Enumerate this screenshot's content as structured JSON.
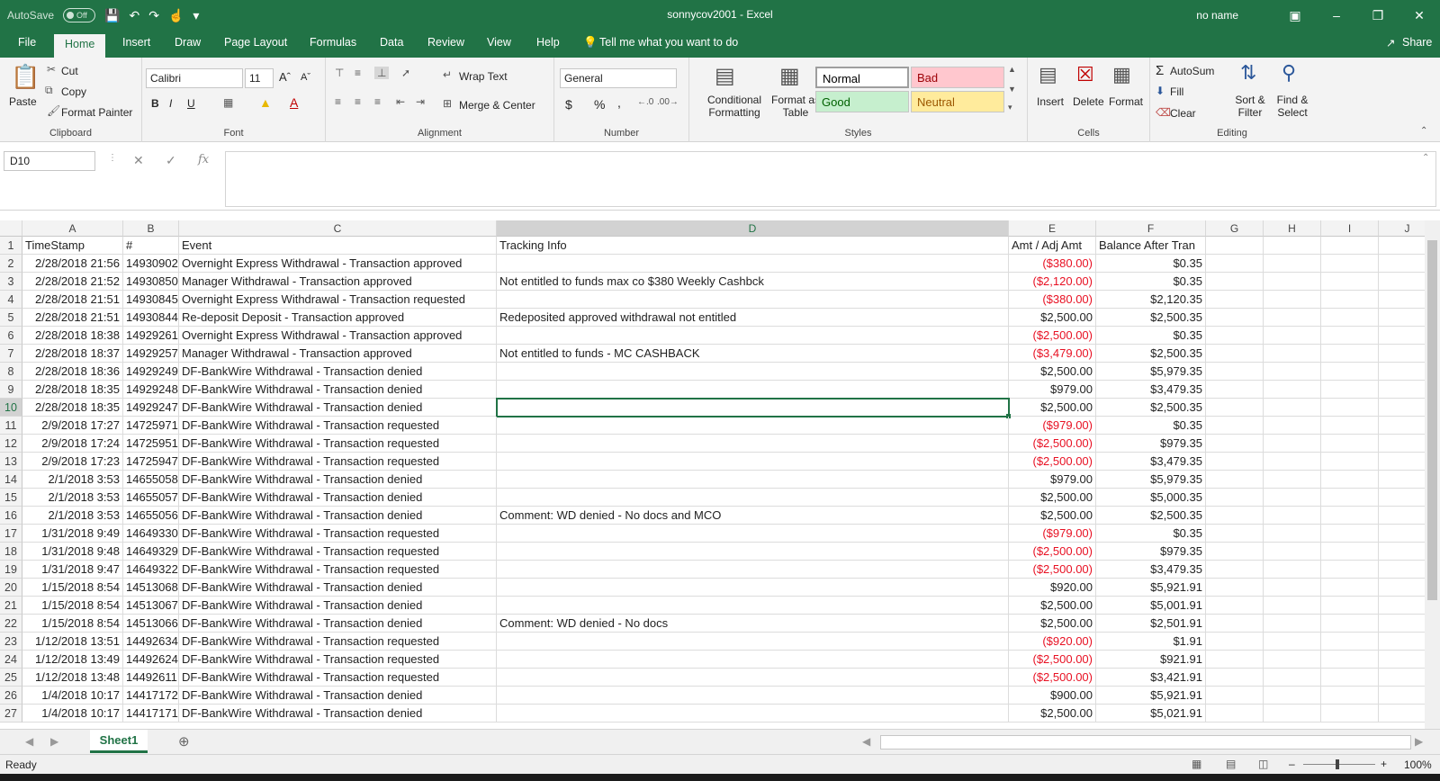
{
  "titlebar": {
    "autosave_label": "AutoSave",
    "autosave_state": "Off",
    "document_title": "sonnycov2001 - Excel",
    "user": "no name"
  },
  "tabs": [
    "File",
    "Home",
    "Insert",
    "Draw",
    "Page Layout",
    "Formulas",
    "Data",
    "Review",
    "View",
    "Help"
  ],
  "active_tab": "Home",
  "tell_me": "Tell me what you want to do",
  "share": "Share",
  "ribbon": {
    "clipboard": {
      "label": "Clipboard",
      "paste": "Paste",
      "cut": "Cut",
      "copy": "Copy",
      "format_painter": "Format Painter"
    },
    "font": {
      "label": "Font",
      "name": "Calibri",
      "size": "11",
      "bold": "B",
      "italic": "I",
      "underline": "U"
    },
    "alignment": {
      "label": "Alignment",
      "wrap_text": "Wrap Text",
      "merge_center": "Merge & Center"
    },
    "number": {
      "label": "Number",
      "format": "General",
      "currency": "$",
      "percent": "%",
      "comma": ","
    },
    "styles": {
      "label": "Styles",
      "conditional_formatting": "Conditional Formatting",
      "format_as_table": "Format as Table",
      "normal": "Normal",
      "bad": "Bad",
      "good": "Good",
      "neutral": "Neutral"
    },
    "cells": {
      "label": "Cells",
      "insert": "Insert",
      "delete": "Delete",
      "format": "Format"
    },
    "editing": {
      "label": "Editing",
      "autosum": "AutoSum",
      "fill": "Fill",
      "clear": "Clear",
      "sort_filter": "Sort & Filter",
      "find_select": "Find & Select"
    }
  },
  "formula_bar": {
    "name_box": "D10",
    "fx": "fx",
    "formula": ""
  },
  "sheet": {
    "columns": [
      "A",
      "B",
      "C",
      "D",
      "E",
      "F",
      "G",
      "H",
      "I",
      "J"
    ],
    "selected_column": "D",
    "selected_row": "10",
    "header_row": [
      "TimeStamp",
      "#",
      "Event",
      "Tracking Info",
      "Amt / Adj Amt",
      "Balance After Tran"
    ],
    "rows": [
      {
        "n": "2",
        "a": "2/28/2018 21:56",
        "b": "14930902",
        "c": "Overnight Express Withdrawal - Transaction approved",
        "d": "",
        "e": "($380.00)",
        "neg": true,
        "f": "$0.35"
      },
      {
        "n": "3",
        "a": "2/28/2018 21:52",
        "b": "14930850",
        "c": "Manager Withdrawal - Transaction approved",
        "d": "Not entitled to funds max co $380 Weekly Cashbck",
        "e": "($2,120.00)",
        "neg": true,
        "f": "$0.35"
      },
      {
        "n": "4",
        "a": "2/28/2018 21:51",
        "b": "14930845",
        "c": "Overnight Express Withdrawal - Transaction requested",
        "d": "",
        "e": "($380.00)",
        "neg": true,
        "f": "$2,120.35"
      },
      {
        "n": "5",
        "a": "2/28/2018 21:51",
        "b": "14930844",
        "c": "Re-deposit Deposit - Transaction approved",
        "d": "Redeposited approved withdrawal not entitled",
        "e": "$2,500.00",
        "neg": false,
        "f": "$2,500.35"
      },
      {
        "n": "6",
        "a": "2/28/2018 18:38",
        "b": "14929261",
        "c": "Overnight Express Withdrawal - Transaction approved",
        "d": "",
        "e": "($2,500.00)",
        "neg": true,
        "f": "$0.35"
      },
      {
        "n": "7",
        "a": "2/28/2018 18:37",
        "b": "14929257",
        "c": "Manager Withdrawal - Transaction approved",
        "d": "Not entitled to funds - MC CASHBACK",
        "e": "($3,479.00)",
        "neg": true,
        "f": "$2,500.35"
      },
      {
        "n": "8",
        "a": "2/28/2018 18:36",
        "b": "14929249",
        "c": "DF-BankWire Withdrawal - Transaction denied",
        "d": "",
        "e": "$2,500.00",
        "neg": false,
        "f": "$5,979.35"
      },
      {
        "n": "9",
        "a": "2/28/2018 18:35",
        "b": "14929248",
        "c": "DF-BankWire Withdrawal - Transaction denied",
        "d": "",
        "e": "$979.00",
        "neg": false,
        "f": "$3,479.35"
      },
      {
        "n": "10",
        "a": "2/28/2018 18:35",
        "b": "14929247",
        "c": "DF-BankWire Withdrawal - Transaction denied",
        "d": "",
        "e": "$2,500.00",
        "neg": false,
        "f": "$2,500.35"
      },
      {
        "n": "11",
        "a": "2/9/2018 17:27",
        "b": "14725971",
        "c": "DF-BankWire Withdrawal - Transaction requested",
        "d": "",
        "e": "($979.00)",
        "neg": true,
        "f": "$0.35"
      },
      {
        "n": "12",
        "a": "2/9/2018 17:24",
        "b": "14725951",
        "c": "DF-BankWire Withdrawal - Transaction requested",
        "d": "",
        "e": "($2,500.00)",
        "neg": true,
        "f": "$979.35"
      },
      {
        "n": "13",
        "a": "2/9/2018 17:23",
        "b": "14725947",
        "c": "DF-BankWire Withdrawal - Transaction requested",
        "d": "",
        "e": "($2,500.00)",
        "neg": true,
        "f": "$3,479.35"
      },
      {
        "n": "14",
        "a": "2/1/2018 3:53",
        "b": "14655058",
        "c": "DF-BankWire Withdrawal - Transaction denied",
        "d": "",
        "e": "$979.00",
        "neg": false,
        "f": "$5,979.35"
      },
      {
        "n": "15",
        "a": "2/1/2018 3:53",
        "b": "14655057",
        "c": "DF-BankWire Withdrawal - Transaction denied",
        "d": "",
        "e": "$2,500.00",
        "neg": false,
        "f": "$5,000.35"
      },
      {
        "n": "16",
        "a": "2/1/2018 3:53",
        "b": "14655056",
        "c": "DF-BankWire Withdrawal - Transaction denied",
        "d": "Comment: WD denied - No docs and MCO",
        "e": "$2,500.00",
        "neg": false,
        "f": "$2,500.35"
      },
      {
        "n": "17",
        "a": "1/31/2018 9:49",
        "b": "14649330",
        "c": "DF-BankWire Withdrawal - Transaction requested",
        "d": "",
        "e": "($979.00)",
        "neg": true,
        "f": "$0.35"
      },
      {
        "n": "18",
        "a": "1/31/2018 9:48",
        "b": "14649329",
        "c": "DF-BankWire Withdrawal - Transaction requested",
        "d": "",
        "e": "($2,500.00)",
        "neg": true,
        "f": "$979.35"
      },
      {
        "n": "19",
        "a": "1/31/2018 9:47",
        "b": "14649322",
        "c": "DF-BankWire Withdrawal - Transaction requested",
        "d": "",
        "e": "($2,500.00)",
        "neg": true,
        "f": "$3,479.35"
      },
      {
        "n": "20",
        "a": "1/15/2018 8:54",
        "b": "14513068",
        "c": "DF-BankWire Withdrawal - Transaction denied",
        "d": "",
        "e": "$920.00",
        "neg": false,
        "f": "$5,921.91"
      },
      {
        "n": "21",
        "a": "1/15/2018 8:54",
        "b": "14513067",
        "c": "DF-BankWire Withdrawal - Transaction denied",
        "d": "",
        "e": "$2,500.00",
        "neg": false,
        "f": "$5,001.91"
      },
      {
        "n": "22",
        "a": "1/15/2018 8:54",
        "b": "14513066",
        "c": "DF-BankWire Withdrawal - Transaction denied",
        "d": "Comment: WD denied - No docs",
        "e": "$2,500.00",
        "neg": false,
        "f": "$2,501.91"
      },
      {
        "n": "23",
        "a": "1/12/2018 13:51",
        "b": "14492634",
        "c": "DF-BankWire Withdrawal - Transaction requested",
        "d": "",
        "e": "($920.00)",
        "neg": true,
        "f": "$1.91"
      },
      {
        "n": "24",
        "a": "1/12/2018 13:49",
        "b": "14492624",
        "c": "DF-BankWire Withdrawal - Transaction requested",
        "d": "",
        "e": "($2,500.00)",
        "neg": true,
        "f": "$921.91"
      },
      {
        "n": "25",
        "a": "1/12/2018 13:48",
        "b": "14492611",
        "c": "DF-BankWire Withdrawal - Transaction requested",
        "d": "",
        "e": "($2,500.00)",
        "neg": true,
        "f": "$3,421.91"
      },
      {
        "n": "26",
        "a": "1/4/2018 10:17",
        "b": "14417172",
        "c": "DF-BankWire Withdrawal - Transaction denied",
        "d": "",
        "e": "$900.00",
        "neg": false,
        "f": "$5,921.91"
      },
      {
        "n": "27",
        "a": "1/4/2018 10:17",
        "b": "14417171",
        "c": "DF-BankWire Withdrawal - Transaction denied",
        "d": "",
        "e": "$2,500.00",
        "neg": false,
        "f": "$5,021.91"
      }
    ]
  },
  "sheet_tab": "Sheet1",
  "status": {
    "mode": "Ready",
    "zoom": "100%"
  },
  "colors": {
    "brand": "#217346",
    "negative": "#e81123",
    "bad_bg": "#ffc7ce",
    "good_bg": "#c6efce",
    "neutral_bg": "#ffeb9c"
  }
}
